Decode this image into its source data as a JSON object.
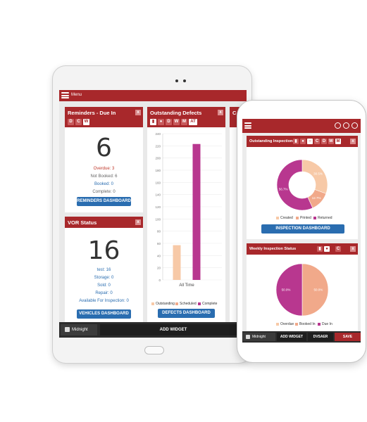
{
  "tablet": {
    "menu_label": "Menu",
    "reminders": {
      "title": "Reminders - Due In",
      "toolbar": [
        "D",
        "C",
        "W"
      ],
      "close": "x",
      "count": "6",
      "overdue": "Overdue: 3",
      "not_booked": "Not Booked: 6",
      "booked": "Booked: 0",
      "complete": "Complete: 0",
      "button": "REMINDERS DASHBOARD"
    },
    "vor": {
      "title": "VOR Status",
      "close": "x",
      "count": "16",
      "items": [
        "test: 16",
        "Storage: 0",
        "Sold: 0",
        "Repair: 0",
        "Available For Inspection: 0"
      ],
      "button": "VEHICLES DASHBOARD"
    },
    "defects": {
      "title": "Outstanding Defects",
      "toolbar": [
        "bar",
        "pie",
        "D",
        "W",
        "M",
        "AT"
      ],
      "close": "x",
      "button": "DEFECTS DASHBOARD"
    },
    "bottom": {
      "theme_label": "Midnight",
      "add_widget": "ADD WIDGET"
    }
  },
  "phone": {
    "inspections": {
      "title": "Outstanding Inspections",
      "toolbar": [
        "bar",
        "pie",
        "C",
        "D",
        "W",
        "M"
      ],
      "close": "x",
      "button": "INSPECTION DASHBOARD"
    },
    "weekly": {
      "title": "Weekly Inspection Status",
      "toolbar": [
        "bar",
        "pie",
        "C"
      ],
      "close": "x"
    },
    "bottom": {
      "theme_label": "Midnight",
      "add_widget": "ADD WIDGET",
      "dvsaer": "DVSAER",
      "save": "SAVE"
    }
  },
  "colors": {
    "brand_red": "#a8282b",
    "button_blue": "#2a6db0",
    "outstanding": "#f7c9a7",
    "scheduled": "#f1a98a",
    "complete": "#b8378f"
  },
  "chart_data": [
    {
      "type": "bar",
      "categories": [
        "All Time"
      ],
      "series": [
        {
          "name": "Outstanding",
          "values": [
            57
          ]
        },
        {
          "name": "Scheduled",
          "values": [
            0
          ]
        },
        {
          "name": "Complete",
          "values": [
            223
          ]
        }
      ],
      "yticks": [
        "0",
        "20",
        "40",
        "60",
        "80",
        "100",
        "120",
        "140",
        "160",
        "180",
        "200",
        "220",
        "240"
      ],
      "ylim": [
        0,
        240
      ]
    },
    {
      "type": "pie",
      "donut": true,
      "series": [
        {
          "name": "Created",
          "value": 30.5
        },
        {
          "name": "Printed",
          "value": 12.7
        },
        {
          "name": "Returned",
          "value": 56.7
        }
      ],
      "labels": [
        "30.5%",
        "12.7%",
        "56.7%"
      ]
    },
    {
      "type": "pie",
      "donut": false,
      "series": [
        {
          "name": "Overdue",
          "value": 0
        },
        {
          "name": "Booked In",
          "value": 50
        },
        {
          "name": "Due In",
          "value": 50
        }
      ],
      "labels": [
        "50.0%",
        "50.0%"
      ]
    }
  ]
}
